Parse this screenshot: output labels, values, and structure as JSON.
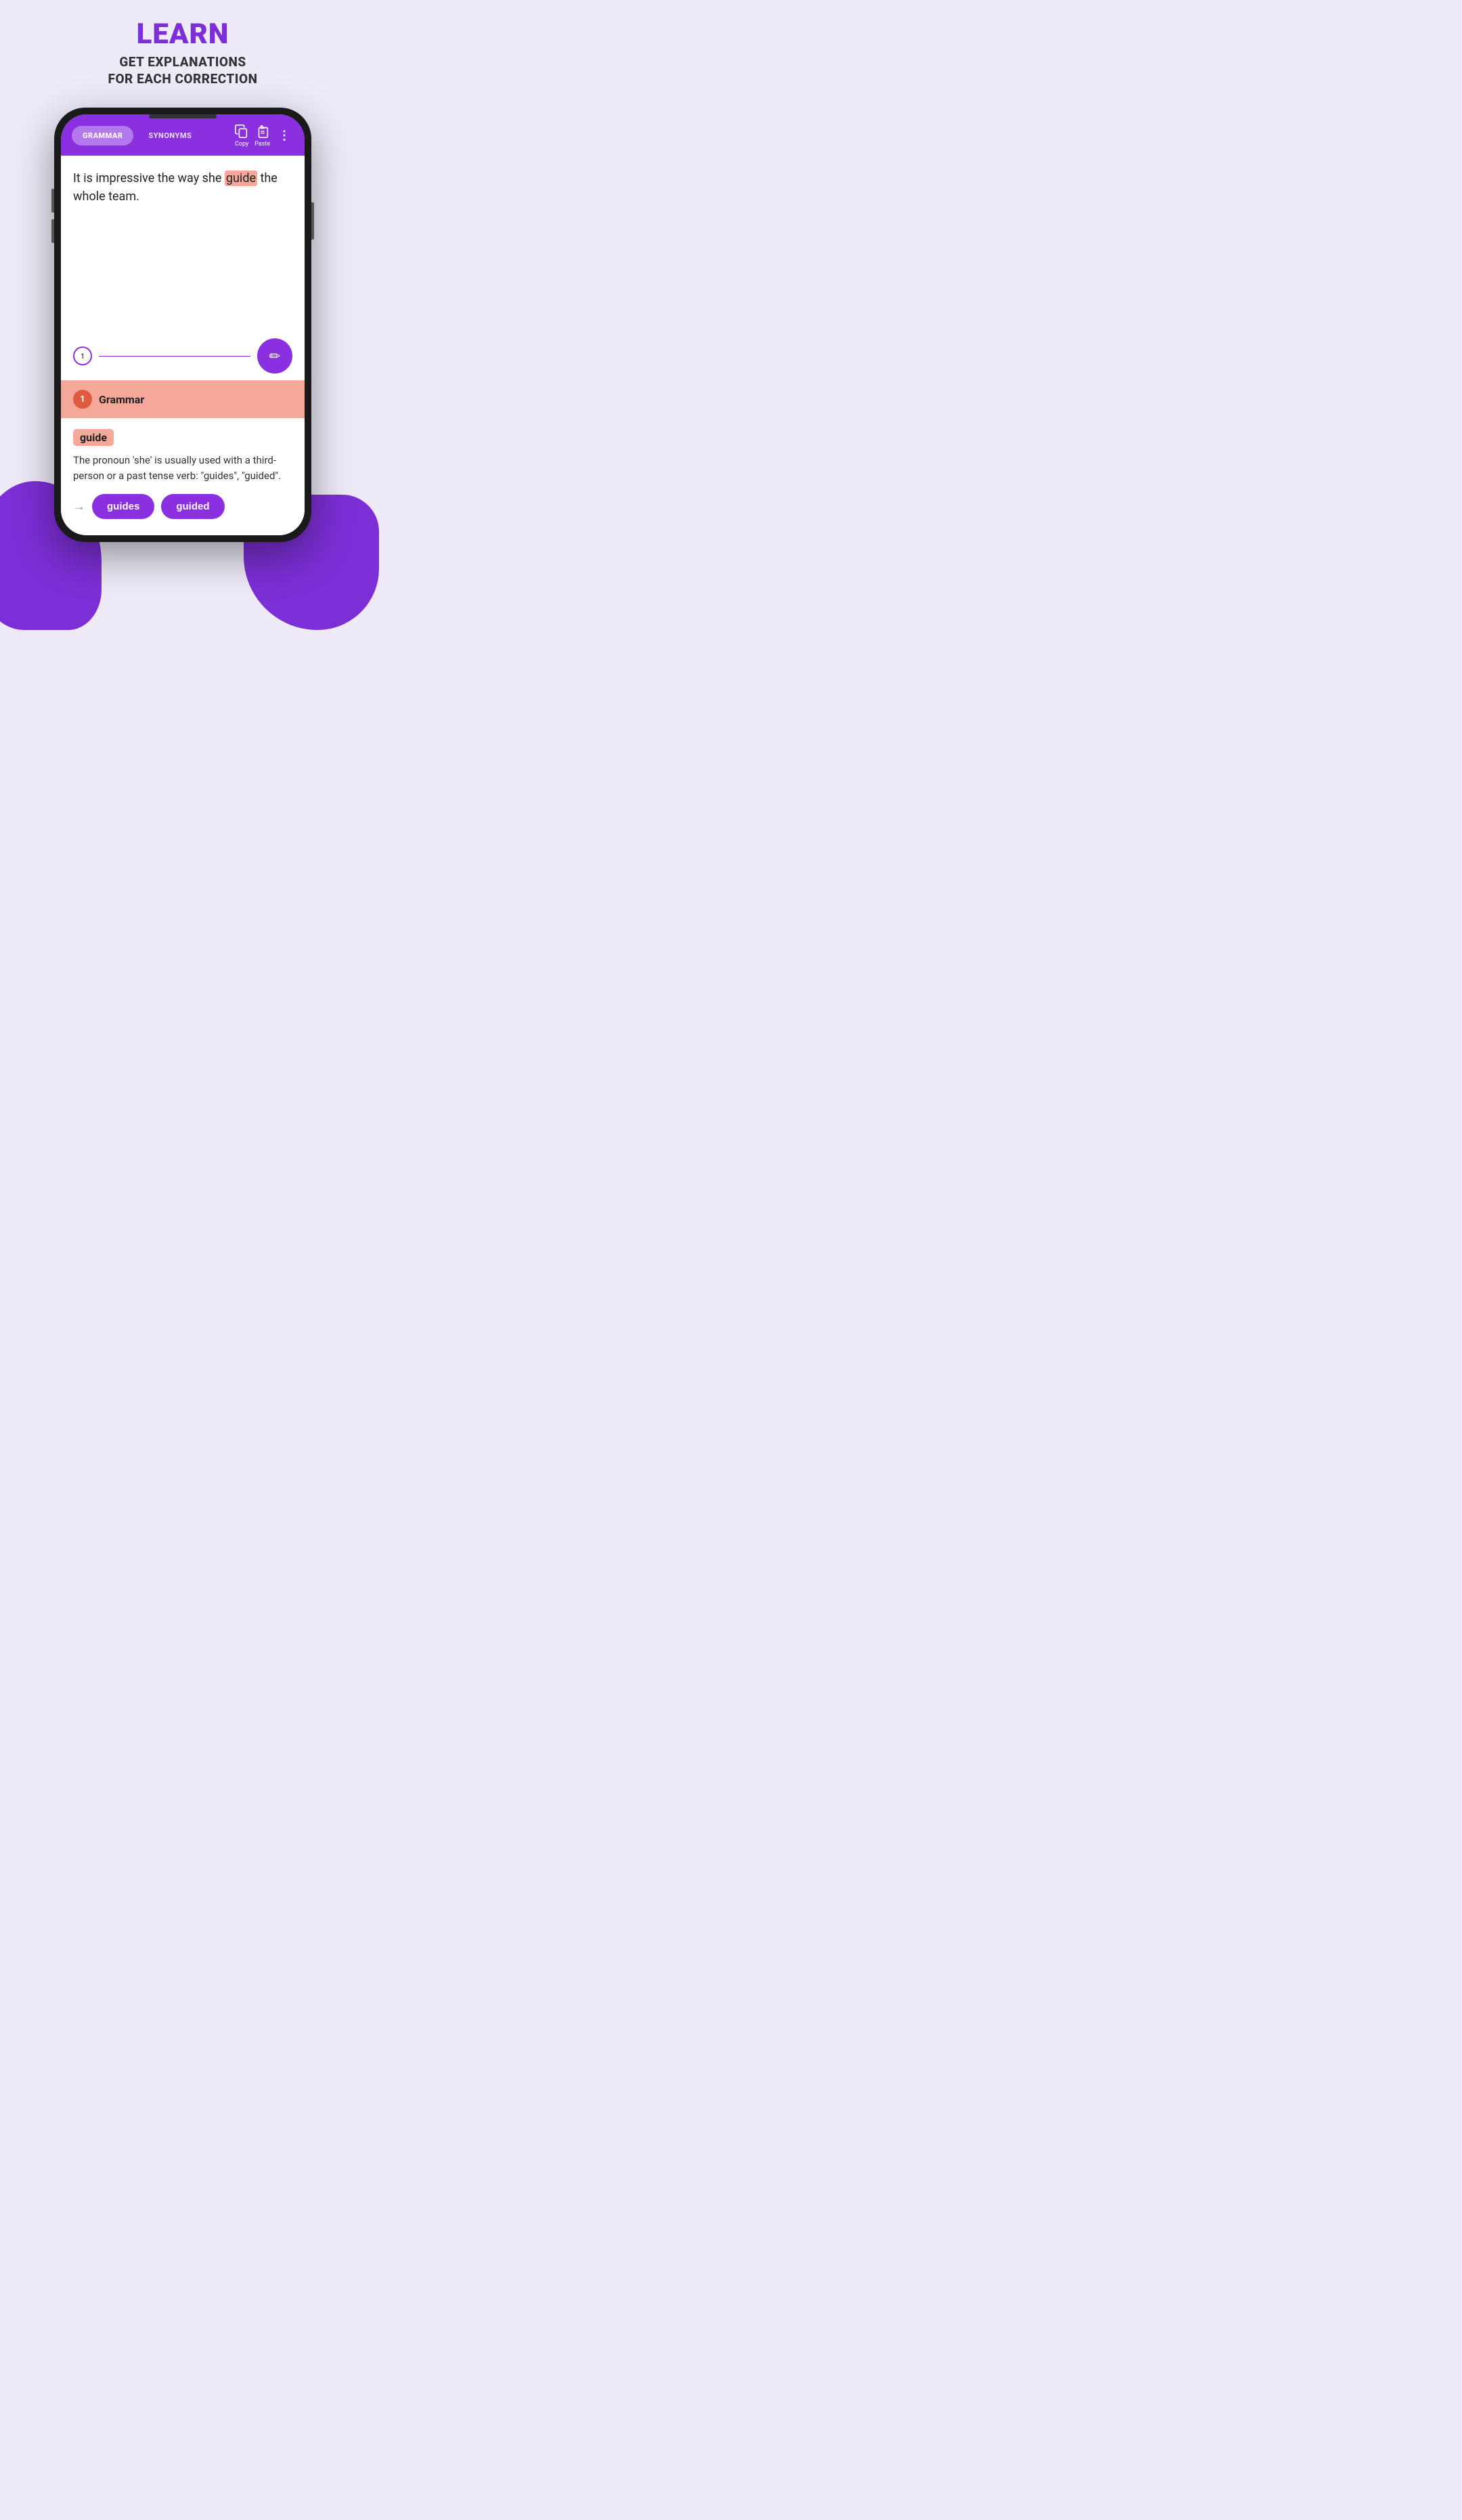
{
  "header": {
    "title": "LEARN",
    "subtitle_line1": "GET EXPLANATIONS",
    "subtitle_line2": "FOR EACH CORRECTION"
  },
  "toolbar": {
    "tab_grammar": "GRAMMAR",
    "tab_synonyms": "SYNONYMS",
    "copy_label": "Copy",
    "paste_label": "Paste"
  },
  "text_content": {
    "before_error": "It is impressive the way she ",
    "error_word": "guide",
    "after_error": " the whole team."
  },
  "divider": {
    "badge_number": "1"
  },
  "correction": {
    "number": "1",
    "type": "Grammar",
    "error_word": "guide",
    "explanation": "The pronoun 'she' is usually used with a third-person or a past tense verb: \"guides\", \"guided\".",
    "suggestion_1": "guides",
    "suggestion_2": "guided"
  }
}
